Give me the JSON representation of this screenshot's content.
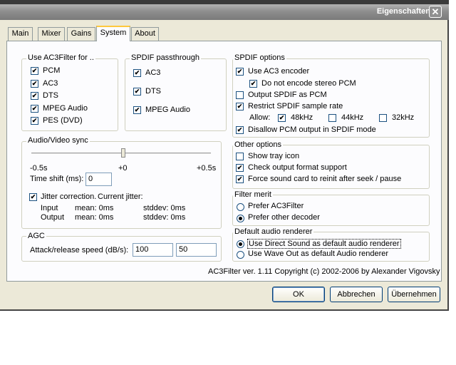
{
  "window": {
    "title": "Eigenschaften",
    "close_glyph": "✕"
  },
  "tabs": [
    {
      "label": "Main",
      "active": false
    },
    {
      "label": "Mixer",
      "active": false
    },
    {
      "label": "Gains",
      "active": false
    },
    {
      "label": "System",
      "active": true
    },
    {
      "label": "About",
      "active": false
    }
  ],
  "use_ac3filter": {
    "legend": "Use AC3Filter for ..",
    "items": [
      {
        "label": "PCM",
        "checked": true
      },
      {
        "label": "AC3",
        "checked": true
      },
      {
        "label": "DTS",
        "checked": true
      },
      {
        "label": "MPEG Audio",
        "checked": true
      },
      {
        "label": "PES (DVD)",
        "checked": true
      }
    ]
  },
  "spdif_passthrough": {
    "legend": "SPDIF passthrough",
    "items": [
      {
        "label": "AC3",
        "checked": true
      },
      {
        "label": "DTS",
        "checked": true
      },
      {
        "label": "MPEG Audio",
        "checked": true
      }
    ]
  },
  "spdif_options": {
    "legend": "SPDIF options",
    "use_ac3_encoder": "Use AC3 encoder",
    "do_not_encode_stereo": "Do not encode stereo PCM",
    "output_spdif_as_pcm": "Output SPDIF as PCM",
    "restrict_sample_rate": "Restrict SPDIF sample rate",
    "allow_label": "Allow:",
    "rate_48": "48kHz",
    "rate_44": "44kHz",
    "rate_32": "32kHz",
    "disallow_pcm": "Disallow PCM output in SPDIF mode"
  },
  "av_sync": {
    "legend": "Audio/Video sync",
    "tick_min": "-0.5s",
    "tick_mid": "+0",
    "tick_max": "+0.5s",
    "time_shift_label": "Time shift (ms):",
    "time_shift_value": "0",
    "slider_value": 0,
    "jitter_label": "Jitter correction.",
    "current_jitter": "Current jitter:",
    "input_label": "Input",
    "output_label": "Output",
    "input_mean": "mean: 0ms",
    "input_stddev": "stddev: 0ms",
    "output_mean": "mean: 0ms",
    "output_stddev": "stddev: 0ms"
  },
  "other_options": {
    "legend": "Other options",
    "show_tray": "Show tray icon",
    "check_output": "Check output format support",
    "force_reinit": "Force sound card to reinit after seek / pause"
  },
  "filter_merit": {
    "legend": "Filter merit",
    "prefer_ac3filter": "Prefer AC3Filter",
    "prefer_other": "Prefer other decoder"
  },
  "agc": {
    "legend": "AGC",
    "attack_label": "Attack/release speed (dB/s):",
    "attack_value": "100",
    "release_value": "50"
  },
  "renderer": {
    "legend": "Default audio renderer",
    "direct_sound": "Use Direct Sound as default audio renderer",
    "wave_out": "Use Wave Out as default Audio renderer"
  },
  "copyright": "AC3Filter ver. 1.11 Copyright (c) 2002-2006 by Alexander Vigovsky",
  "buttons": {
    "ok": "OK",
    "cancel": "Abbrechen",
    "apply": "Übernehmen"
  }
}
